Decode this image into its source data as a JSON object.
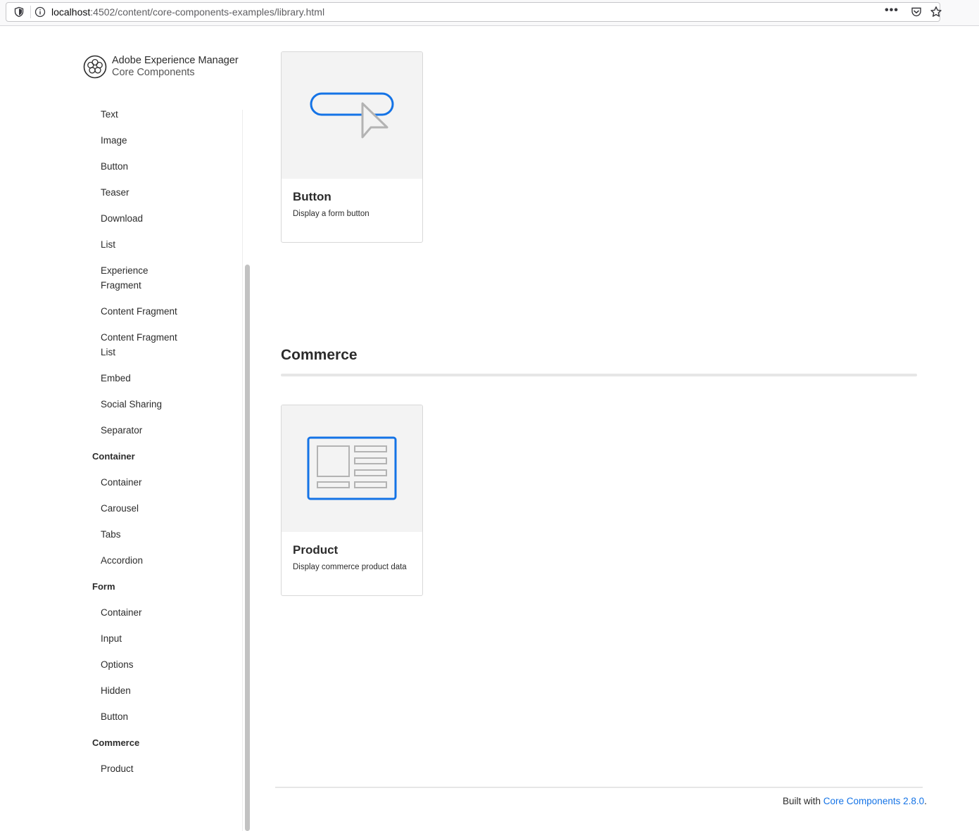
{
  "browser": {
    "url_host": "localhost",
    "url_rest": ":4502/content/core-components-examples/library.html",
    "icons": [
      "shield-icon",
      "info-icon",
      "more-icon",
      "pocket-icon",
      "star-icon"
    ]
  },
  "logo": {
    "line1": "Adobe Experience Manager",
    "line2": "Core Components"
  },
  "sidebar": {
    "items": [
      {
        "label": "Text"
      },
      {
        "label": "Image"
      },
      {
        "label": "Button"
      },
      {
        "label": "Teaser"
      },
      {
        "label": "Download"
      },
      {
        "label": "List"
      },
      {
        "label": "Experience",
        "label2": "Fragment"
      },
      {
        "label": "Content Fragment"
      },
      {
        "label": "Content Fragment",
        "label2": "List"
      },
      {
        "label": "Embed"
      },
      {
        "label": "Social Sharing"
      },
      {
        "label": "Separator"
      }
    ],
    "groups": [
      {
        "title": "Container",
        "items": [
          "Container",
          "Carousel",
          "Tabs",
          "Accordion"
        ]
      },
      {
        "title": "Form",
        "items": [
          "Container",
          "Input",
          "Options",
          "Hidden",
          "Button"
        ]
      },
      {
        "title": "Commerce",
        "items": [
          "Product"
        ]
      }
    ]
  },
  "main": {
    "cards": [
      {
        "title": "Button",
        "description": "Display a form button",
        "icon": "button-cursor-icon"
      },
      {
        "title": "Product",
        "description": "Display commerce product data",
        "icon": "product-layout-icon"
      }
    ],
    "section_title": "Commerce"
  },
  "footer": {
    "prefix": "Built with ",
    "link_text": "Core Components 2.8.0",
    "suffix": "."
  },
  "colors": {
    "accent": "#1473e6",
    "card_media_bg": "#f3f3f3",
    "text": "#2c2c2c"
  }
}
